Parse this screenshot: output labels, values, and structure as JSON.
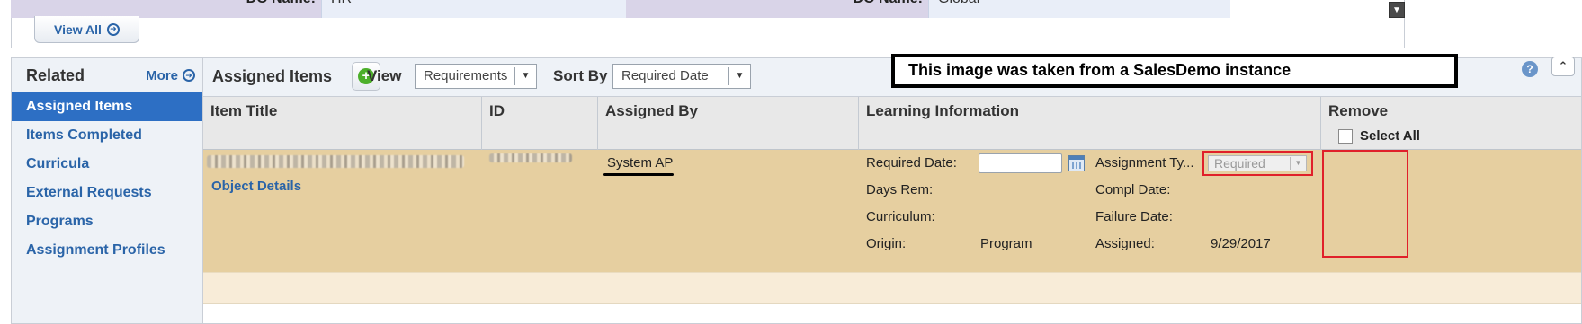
{
  "top_section": {
    "label_left": "DO Name:",
    "value_left": "HR",
    "label_right": "DO Name:",
    "value_right": "Global",
    "view_all_label": "View All"
  },
  "related": {
    "title": "Related",
    "more_label": "More",
    "items": [
      {
        "label": "Assigned Items",
        "active": true
      },
      {
        "label": "Items Completed",
        "active": false
      },
      {
        "label": "Curricula",
        "active": false
      },
      {
        "label": "External Requests",
        "active": false
      },
      {
        "label": "Programs",
        "active": false
      },
      {
        "label": "Assignment Profiles",
        "active": false
      }
    ]
  },
  "toolbar": {
    "title": "Assigned Items",
    "view_label": "View",
    "view_value": "Requirements",
    "sort_label": "Sort By",
    "sort_value": "Required Date",
    "notice": "This image was taken from a SalesDemo instance"
  },
  "table": {
    "headers": {
      "item_title": "Item Title",
      "id": "ID",
      "assigned_by": "Assigned By",
      "learning_info": "Learning Information",
      "remove": "Remove"
    },
    "select_all_label": "Select All",
    "row": {
      "object_details_label": "Object Details",
      "assigned_by": "System AP",
      "required_date_label": "Required Date:",
      "required_date_value": "",
      "days_rem_label": "Days Rem:",
      "curriculum_label": "Curriculum:",
      "origin_label": "Origin:",
      "origin_value": "Program",
      "assignment_type_label": "Assignment Ty...",
      "assignment_type_value": "Required",
      "compl_date_label": "Compl Date:",
      "failure_date_label": "Failure Date:",
      "assigned_label": "Assigned:",
      "assigned_value": "9/29/2017"
    }
  },
  "colors": {
    "accent_blue": "#2d6fc4",
    "link_blue": "#2a64a8",
    "row_highlight": "#e6cfa0",
    "annotation_red": "#e0202a"
  }
}
